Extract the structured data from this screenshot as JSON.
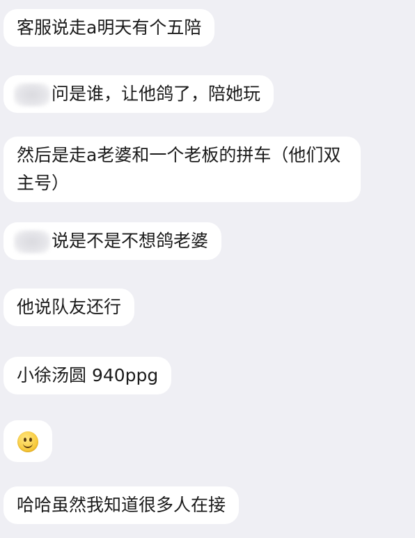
{
  "messages": [
    {
      "text": "客服说走a明天有个五陪"
    },
    {
      "text": "问是谁，让他鸽了，陪她玩",
      "redacted_prefix": true
    },
    {
      "text": "然后是走a老婆和一个老板的拼车（他们双主号）"
    },
    {
      "text": "说是不是不想鸽老婆",
      "redacted_prefix": true
    },
    {
      "text": "他说队友还行"
    },
    {
      "text": "小徐汤圆 940ppg"
    },
    {
      "emoji": "slightly-smiling-face-icon"
    },
    {
      "text": "哈哈虽然我知道很多人在接"
    }
  ],
  "colors": {
    "background": "#efeff4",
    "bubble": "#ffffff",
    "text": "#1a1a1a"
  }
}
